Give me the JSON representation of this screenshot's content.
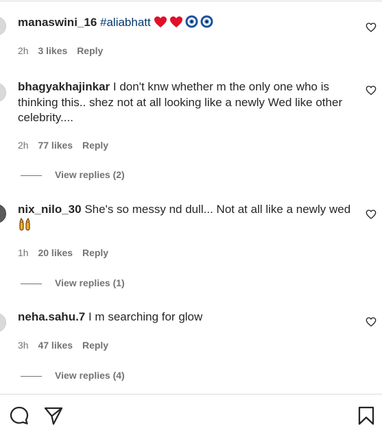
{
  "comments": [
    {
      "username": "manaswini_16",
      "text_pre": "",
      "hashtag": "#aliabhatt",
      "text_post": " ",
      "time": "2h",
      "likes": "3 likes",
      "reply": "Reply",
      "view_replies": ""
    },
    {
      "username": "bhagyakhajinkar",
      "text_pre": " I don't knw whether m the only one who is thinking this.. shez not at all looking like a newly Wed like other celebrity....",
      "time": "2h",
      "likes": "77 likes",
      "reply": "Reply",
      "view_replies": "View replies (2)"
    },
    {
      "username": "nix_nilo_30",
      "text_pre": " She's so messy nd dull... Not at all like a newly wed",
      "time": "1h",
      "likes": "20 likes",
      "reply": "Reply",
      "view_replies": "View replies (1)"
    },
    {
      "username": "neha.sahu.7",
      "text_pre": " I m searching for glow",
      "time": "3h",
      "likes": "47 likes",
      "reply": "Reply",
      "view_replies": "View replies (4)"
    }
  ],
  "icons": {
    "like": "heart-outline-icon",
    "comment": "comment-bubble-icon",
    "share": "paper-plane-icon",
    "save": "bookmark-icon"
  },
  "colors": {
    "heart_red": "#e0102a",
    "evil_eye_blue": "#1d4fa0",
    "hashtag": "#00376b",
    "muted": "#737373"
  }
}
